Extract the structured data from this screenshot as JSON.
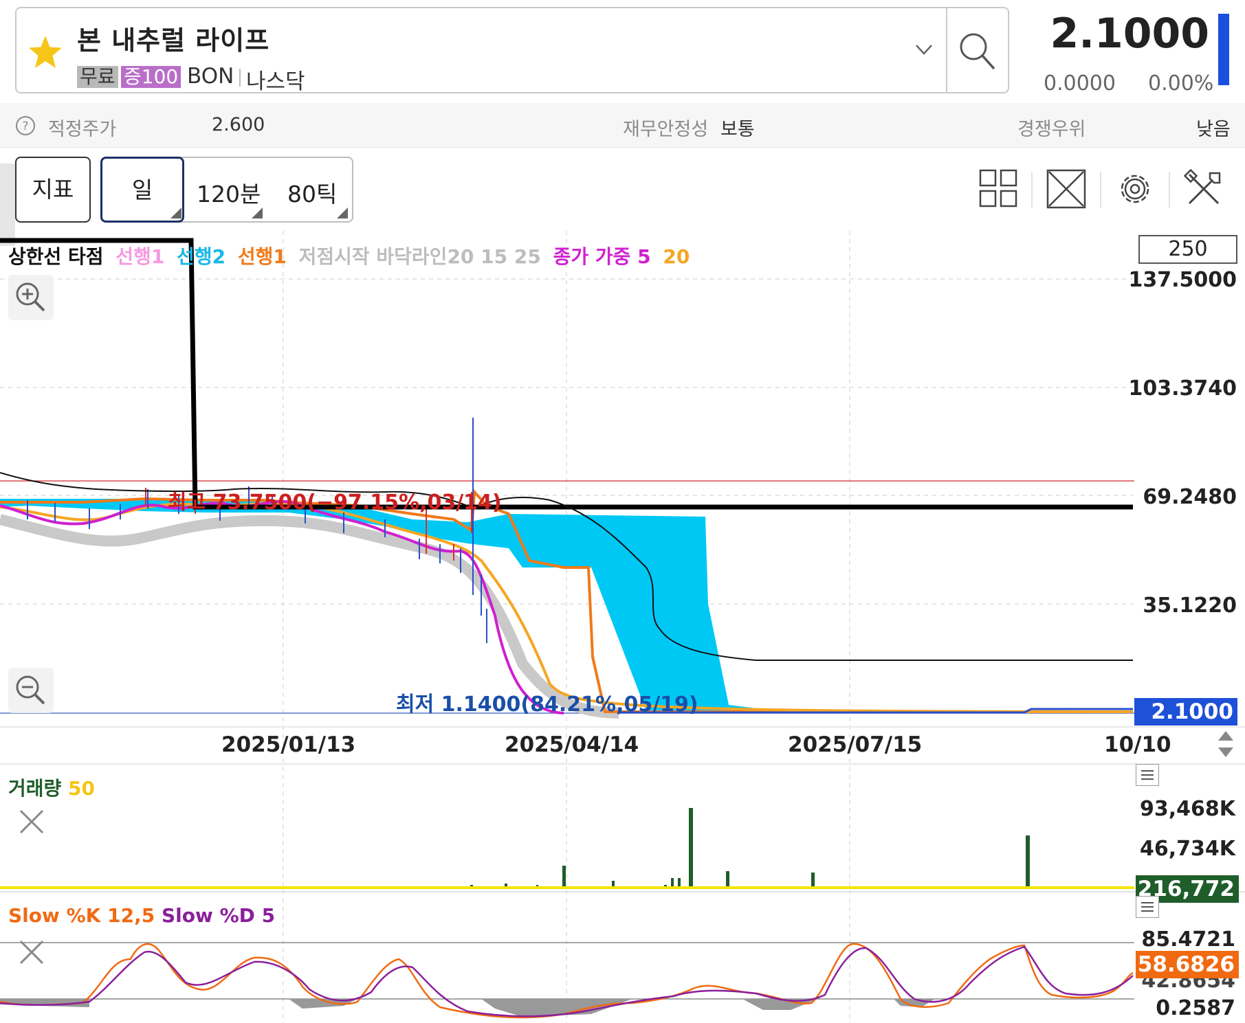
{
  "header": {
    "stock_name": "본 내추럴 라이프",
    "tags": [
      "무료",
      "증100"
    ],
    "ticker": "BON",
    "market": "나스닥",
    "price": "2.1000",
    "change": "0.0000",
    "change_rate": "0.00%"
  },
  "info_bar": {
    "fair_price_label": "적정주가",
    "fair_price_value": "2.600",
    "fin_stability_label": "재무안정성",
    "fin_stability_value": "보통",
    "competitive_label": "경쟁우위",
    "competitive_value": "낮음"
  },
  "toolbar": {
    "indicator_label": "지표",
    "periods": [
      "일",
      "120분",
      "80틱"
    ]
  },
  "main_chart": {
    "legend": [
      {
        "text": "상한선 타점",
        "color": "#111111"
      },
      {
        "text": "선행1",
        "color": "#f59be0"
      },
      {
        "text": "선행2",
        "color": "#1ab8e8"
      },
      {
        "text": "선행1",
        "color": "#f07a1a"
      },
      {
        "text": "저점시작 바닥라인20 15 25",
        "color": "#bdbdbd"
      },
      {
        "text": "종가 가중 5",
        "color": "#d020d0"
      },
      {
        "text": "20",
        "color": "#f5a623"
      }
    ],
    "count": "250",
    "y_ticks": [
      "137.5000",
      "103.3740",
      "69.2480",
      "35.1220"
    ],
    "x_ticks": [
      "2025/01/13",
      "2025/04/14",
      "2025/07/15",
      "10/10"
    ],
    "current_price": "2.1000",
    "high_label": "최고 73.7500(−97.15%,03/14)",
    "low_label": "최저 1.1400(84.21%,05/19)",
    "colors": {
      "cloud": "#00c8f5",
      "price_tag": "#1e50d8",
      "upper_line": "#000000"
    }
  },
  "volume": {
    "legend_name": "거래량",
    "legend_param": "50",
    "y_ticks": [
      "93,468K",
      "46,734K"
    ],
    "current": "216,772"
  },
  "stochastic": {
    "legend_k": "Slow %K 12,5",
    "legend_d": "Slow %D 5",
    "y_ticks": [
      "85.4721",
      "42.8654",
      "0.2587"
    ],
    "current": "58.6826"
  }
}
